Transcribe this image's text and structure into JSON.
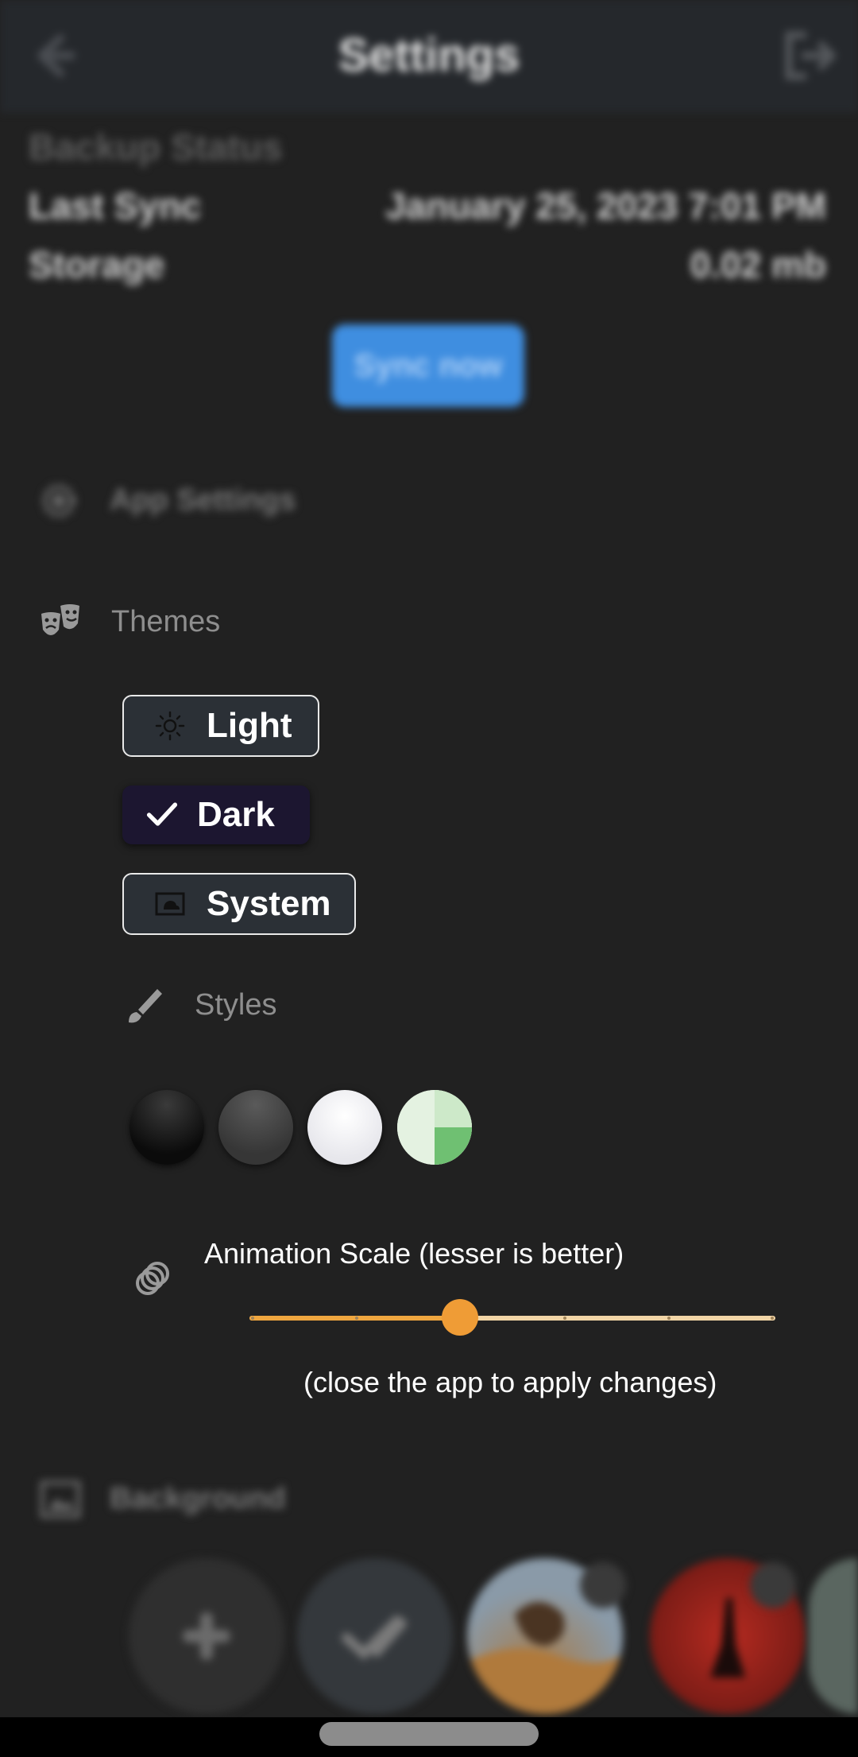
{
  "header": {
    "title": "Settings",
    "back_icon": "arrow-left-icon",
    "logout_icon": "logout-icon"
  },
  "backup": {
    "title": "Backup Status",
    "last_sync_label": "Last Sync",
    "last_sync_value": "January 25, 2023 7:01 PM",
    "storage_label": "Storage",
    "storage_value": "0.02 mb",
    "sync_button": "Sync now"
  },
  "app_settings": {
    "label": "App Settings",
    "icon": "gear-icon"
  },
  "themes": {
    "label": "Themes",
    "icon": "theater-masks-icon",
    "options": [
      {
        "label": "Light",
        "icon": "sun-icon",
        "selected": false
      },
      {
        "label": "Dark",
        "icon": "check-icon",
        "selected": true
      },
      {
        "label": "System",
        "icon": "device-theme-icon",
        "selected": false
      }
    ]
  },
  "styles": {
    "label": "Styles",
    "icon": "brush-icon",
    "swatches": [
      "black",
      "dark-gray",
      "white",
      "green"
    ]
  },
  "animation": {
    "title": "Animation Scale (lesser is better)",
    "note": "(close the app to apply changes)",
    "icon": "animation-rings-icon",
    "slider_value_fraction": 0.4,
    "slider_steps": 5,
    "accent_color": "#EF9C36"
  },
  "background": {
    "label": "Background",
    "icon": "image-icon",
    "items": [
      "add",
      "check",
      "image-1",
      "image-2",
      "image-3"
    ]
  }
}
